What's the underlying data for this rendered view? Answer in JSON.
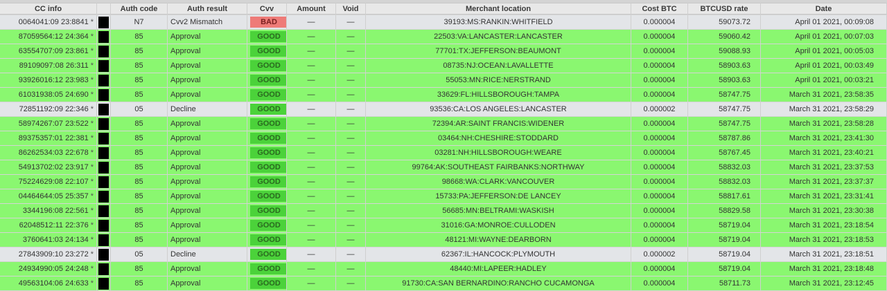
{
  "columns": [
    "CC info",
    "",
    "Auth code",
    "Auth result",
    "Cvv",
    "Amount",
    "Void",
    "Merchant location",
    "Cost BTC",
    "BTCUSD rate",
    "Date"
  ],
  "colors": {
    "approval_row": "#8af770",
    "neutral_row": "#e3e5e8",
    "good_badge": "#4bd23a",
    "bad_badge": "#ee7b78"
  },
  "rows": [
    {
      "cc": "0064041:09 23:8841",
      "star": "*",
      "auth_code": "N7",
      "auth_result": "Cvv2 Mismatch",
      "cvv": "BAD",
      "amount": "—",
      "void": "—",
      "merchant": "39193:MS:RANKIN:WHITFIELD",
      "cost_btc": "0.000004",
      "rate": "59073.72",
      "date": "April 01 2021, 00:09:08"
    },
    {
      "cc": "87059564:12 24:364",
      "star": "*",
      "auth_code": "85",
      "auth_result": "Approval",
      "cvv": "GOOD",
      "amount": "—",
      "void": "—",
      "merchant": "22503:VA:LANCASTER:LANCASTER",
      "cost_btc": "0.000004",
      "rate": "59060.42",
      "date": "April 01 2021, 00:07:03"
    },
    {
      "cc": "63554707:09 23:861",
      "star": "*",
      "auth_code": "85",
      "auth_result": "Approval",
      "cvv": "GOOD",
      "amount": "—",
      "void": "—",
      "merchant": "77701:TX:JEFFERSON:BEAUMONT",
      "cost_btc": "0.000004",
      "rate": "59088.93",
      "date": "April 01 2021, 00:05:03"
    },
    {
      "cc": "89109097:08 26:311",
      "star": "*",
      "auth_code": "85",
      "auth_result": "Approval",
      "cvv": "GOOD",
      "amount": "—",
      "void": "—",
      "merchant": "08735:NJ:OCEAN:LAVALLETTE",
      "cost_btc": "0.000004",
      "rate": "58903.63",
      "date": "April 01 2021, 00:03:49"
    },
    {
      "cc": "93926016:12 23:983",
      "star": "*",
      "auth_code": "85",
      "auth_result": "Approval",
      "cvv": "GOOD",
      "amount": "—",
      "void": "—",
      "merchant": "55053:MN:RICE:NERSTRAND",
      "cost_btc": "0.000004",
      "rate": "58903.63",
      "date": "April 01 2021, 00:03:21"
    },
    {
      "cc": "61031938:05 24:690",
      "star": "*",
      "auth_code": "85",
      "auth_result": "Approval",
      "cvv": "GOOD",
      "amount": "—",
      "void": "—",
      "merchant": "33629:FL:HILLSBOROUGH:TAMPA",
      "cost_btc": "0.000004",
      "rate": "58747.75",
      "date": "March 31 2021, 23:58:35"
    },
    {
      "cc": "72851192:09 22:346",
      "star": "*",
      "auth_code": "05",
      "auth_result": "Decline",
      "cvv": "GOOD",
      "amount": "—",
      "void": "—",
      "merchant": "93536:CA:LOS ANGELES:LANCASTER",
      "cost_btc": "0.000002",
      "rate": "58747.75",
      "date": "March 31 2021, 23:58:29"
    },
    {
      "cc": "58974267:07 23:522",
      "star": "*",
      "auth_code": "85",
      "auth_result": "Approval",
      "cvv": "GOOD",
      "amount": "—",
      "void": "—",
      "merchant": "72394:AR:SAINT FRANCIS:WIDENER",
      "cost_btc": "0.000004",
      "rate": "58747.75",
      "date": "March 31 2021, 23:58:28"
    },
    {
      "cc": "89375357:01 22:381",
      "star": "*",
      "auth_code": "85",
      "auth_result": "Approval",
      "cvv": "GOOD",
      "amount": "—",
      "void": "—",
      "merchant": "03464:NH:CHESHIRE:STODDARD",
      "cost_btc": "0.000004",
      "rate": "58787.86",
      "date": "March 31 2021, 23:41:30"
    },
    {
      "cc": "86262534:03 22:678",
      "star": "*",
      "auth_code": "85",
      "auth_result": "Approval",
      "cvv": "GOOD",
      "amount": "—",
      "void": "—",
      "merchant": "03281:NH:HILLSBOROUGH:WEARE",
      "cost_btc": "0.000004",
      "rate": "58767.45",
      "date": "March 31 2021, 23:40:21"
    },
    {
      "cc": "54913702:02 23:917",
      "star": "*",
      "auth_code": "85",
      "auth_result": "Approval",
      "cvv": "GOOD",
      "amount": "—",
      "void": "—",
      "merchant": "99764:AK:SOUTHEAST FAIRBANKS:NORTHWAY",
      "cost_btc": "0.000004",
      "rate": "58832.03",
      "date": "March 31 2021, 23:37:53"
    },
    {
      "cc": "75224629:08 22:107",
      "star": "*",
      "auth_code": "85",
      "auth_result": "Approval",
      "cvv": "GOOD",
      "amount": "—",
      "void": "—",
      "merchant": "98668:WA:CLARK:VANCOUVER",
      "cost_btc": "0.000004",
      "rate": "58832.03",
      "date": "March 31 2021, 23:37:37"
    },
    {
      "cc": "04464644:05 25:357",
      "star": "*",
      "auth_code": "85",
      "auth_result": "Approval",
      "cvv": "GOOD",
      "amount": "—",
      "void": "—",
      "merchant": "15733:PA:JEFFERSON:DE LANCEY",
      "cost_btc": "0.000004",
      "rate": "58817.61",
      "date": "March 31 2021, 23:31:41"
    },
    {
      "cc": "3344196:08 22:561",
      "star": "*",
      "auth_code": "85",
      "auth_result": "Approval",
      "cvv": "GOOD",
      "amount": "—",
      "void": "—",
      "merchant": "56685:MN:BELTRAMI:WASKISH",
      "cost_btc": "0.000004",
      "rate": "58829.58",
      "date": "March 31 2021, 23:30:38"
    },
    {
      "cc": "62048512:11 22:376",
      "star": "*",
      "auth_code": "85",
      "auth_result": "Approval",
      "cvv": "GOOD",
      "amount": "—",
      "void": "—",
      "merchant": "31016:GA:MONROE:CULLODEN",
      "cost_btc": "0.000004",
      "rate": "58719.04",
      "date": "March 31 2021, 23:18:54"
    },
    {
      "cc": "3760641:03 24:134",
      "star": "*",
      "auth_code": "85",
      "auth_result": "Approval",
      "cvv": "GOOD",
      "amount": "—",
      "void": "—",
      "merchant": "48121:MI:WAYNE:DEARBORN",
      "cost_btc": "0.000004",
      "rate": "58719.04",
      "date": "March 31 2021, 23:18:53"
    },
    {
      "cc": "27843909:10 23:272",
      "star": "*",
      "auth_code": "05",
      "auth_result": "Decline",
      "cvv": "GOOD",
      "amount": "—",
      "void": "—",
      "merchant": "62367:IL:HANCOCK:PLYMOUTH",
      "cost_btc": "0.000002",
      "rate": "58719.04",
      "date": "March 31 2021, 23:18:51"
    },
    {
      "cc": "24934990:05 24:248",
      "star": "*",
      "auth_code": "85",
      "auth_result": "Approval",
      "cvv": "GOOD",
      "amount": "—",
      "void": "—",
      "merchant": "48440:MI:LAPEER:HADLEY",
      "cost_btc": "0.000004",
      "rate": "58719.04",
      "date": "March 31 2021, 23:18:48"
    },
    {
      "cc": "49563104:06 24:633",
      "star": "*",
      "auth_code": "85",
      "auth_result": "Approval",
      "cvv": "GOOD",
      "amount": "—",
      "void": "—",
      "merchant": "91730:CA:SAN BERNARDINO:RANCHO CUCAMONGA",
      "cost_btc": "0.000004",
      "rate": "58711.73",
      "date": "March 31 2021, 23:12:45"
    }
  ]
}
